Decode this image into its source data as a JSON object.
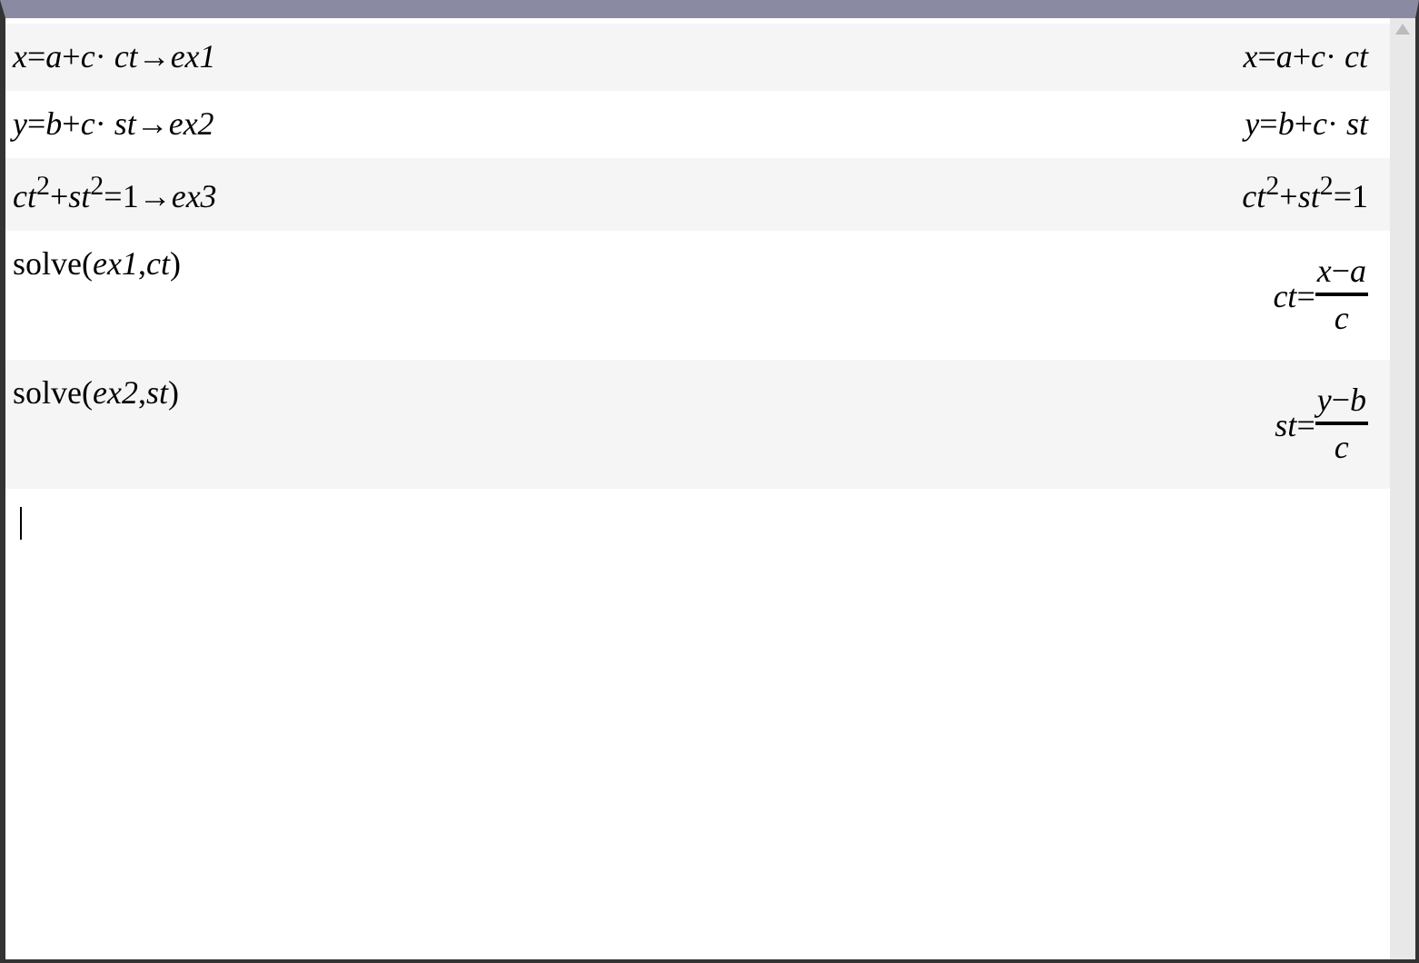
{
  "entries": [
    {
      "input": "*x*=*a*+*c*· *ct*→*ex1*",
      "output": {
        "kind": "text",
        "text": "*x*=*a*+*c*· *ct*"
      }
    },
    {
      "input": "*y*=*b*+*c*· *st*→*ex2*",
      "output": {
        "kind": "text",
        "text": "*y*=*b*+*c*· *st*"
      }
    },
    {
      "input": "*ct*$^{2}$+*st*$^{2}$=1→*ex3*",
      "output": {
        "kind": "text",
        "text": "*ct*$^{2}$+*st*$^{2}$=1"
      }
    },
    {
      "input": "solve(*ex1*,*ct*)",
      "output": {
        "kind": "fraction",
        "lhs": "*ct*=",
        "numerator": "*x*−*a*",
        "denominator": "*c*"
      }
    },
    {
      "input": "solve(*ex2*,*st*)",
      "output": {
        "kind": "fraction",
        "lhs": "*st*=",
        "numerator": "*y*−*b*",
        "denominator": "*c*"
      }
    }
  ]
}
